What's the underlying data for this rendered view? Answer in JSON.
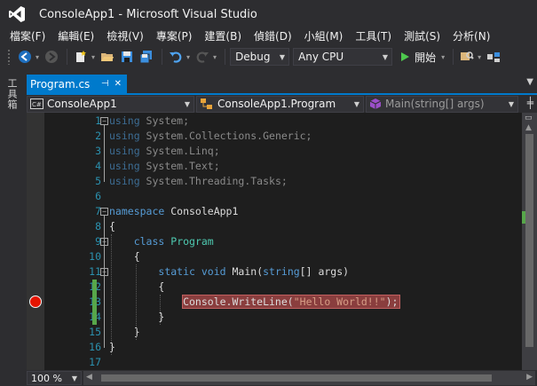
{
  "window": {
    "title": "ConsoleApp1 - Microsoft Visual Studio"
  },
  "menu": [
    "檔案(F)",
    "編輯(E)",
    "檢視(V)",
    "專案(P)",
    "建置(B)",
    "偵錯(D)",
    "小組(M)",
    "工具(T)",
    "測試(S)",
    "分析(N)"
  ],
  "toolbar": {
    "configuration": "Debug",
    "platform": "Any CPU",
    "start_label": "開始"
  },
  "toolbox": {
    "label": "工具箱"
  },
  "tab": {
    "label": "Program.cs",
    "pin_glyph": "⊣",
    "close_glyph": "✕"
  },
  "nav": {
    "project": "ConsoleApp1",
    "class": "ConsoleApp1.Program",
    "member": "Main(string[] args)"
  },
  "editor": {
    "lines": [
      {
        "n": "1",
        "tokens": [
          [
            "kw-dim",
            "using"
          ],
          [
            "dim",
            " System;"
          ]
        ]
      },
      {
        "n": "2",
        "tokens": [
          [
            "kw-dim",
            "using"
          ],
          [
            "dim",
            " System.Collections.Generic;"
          ]
        ]
      },
      {
        "n": "3",
        "tokens": [
          [
            "kw-dim",
            "using"
          ],
          [
            "dim",
            " System.Linq;"
          ]
        ]
      },
      {
        "n": "4",
        "tokens": [
          [
            "kw-dim",
            "using"
          ],
          [
            "dim",
            " System.Text;"
          ]
        ]
      },
      {
        "n": "5",
        "tokens": [
          [
            "kw-dim",
            "using"
          ],
          [
            "dim",
            " System.Threading.Tasks;"
          ]
        ]
      },
      {
        "n": "6",
        "tokens": []
      },
      {
        "n": "7",
        "tokens": [
          [
            "kw",
            "namespace"
          ],
          [
            "plain",
            " ConsoleApp1"
          ]
        ]
      },
      {
        "n": "8",
        "tokens": [
          [
            "plain",
            "{"
          ]
        ]
      },
      {
        "n": "9",
        "tokens": [
          [
            "plain",
            "    "
          ],
          [
            "kw",
            "class"
          ],
          [
            "plain",
            " "
          ],
          [
            "ty",
            "Program"
          ]
        ]
      },
      {
        "n": "10",
        "tokens": [
          [
            "plain",
            "    {"
          ]
        ]
      },
      {
        "n": "11",
        "tokens": [
          [
            "plain",
            "        "
          ],
          [
            "kw",
            "static"
          ],
          [
            "plain",
            " "
          ],
          [
            "kw",
            "void"
          ],
          [
            "plain",
            " Main("
          ],
          [
            "kw",
            "string"
          ],
          [
            "plain",
            "[] args)"
          ]
        ]
      },
      {
        "n": "12",
        "tokens": [
          [
            "plain",
            "        {"
          ]
        ]
      },
      {
        "n": "13",
        "tokens": [
          [
            "plain",
            "            Console.WriteLine("
          ],
          [
            "str",
            "\"Hello World!!\""
          ],
          [
            "plain",
            ");"
          ]
        ]
      },
      {
        "n": "14",
        "tokens": [
          [
            "plain",
            "        }"
          ]
        ]
      },
      {
        "n": "15",
        "tokens": [
          [
            "plain",
            "    }"
          ]
        ]
      },
      {
        "n": "16",
        "tokens": [
          [
            "plain",
            "}"
          ]
        ]
      },
      {
        "n": "17",
        "tokens": []
      }
    ],
    "breakpoint_line": "13"
  },
  "status": {
    "zoom": "100 %"
  }
}
